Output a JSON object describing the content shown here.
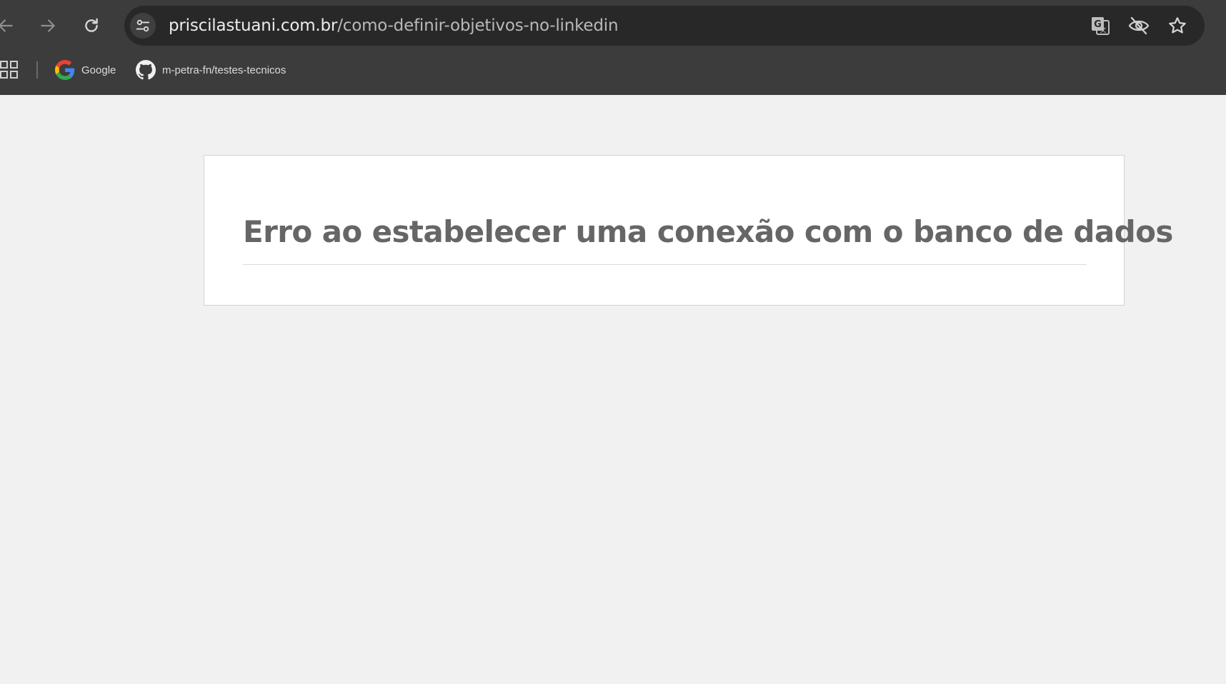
{
  "browser": {
    "url_domain": "priscilastuani.com.br",
    "url_path": "/como-definir-objetivos-no-linkedin",
    "toolbar": {
      "back_icon": "arrow-left-icon",
      "forward_icon": "arrow-right-icon",
      "reload_icon": "reload-icon",
      "site_info_icon": "tune-icon",
      "translate_icon": "translate-icon",
      "tracking_icon": "eye-off-icon",
      "bookmark_icon": "star-icon"
    },
    "bookmarks": [
      {
        "label": "Google",
        "icon": "google-icon"
      },
      {
        "label": "m-petra-fn/testes-tecnicos",
        "icon": "github-icon"
      }
    ],
    "colors": {
      "chrome": "#3c3c3c",
      "omnibox": "#282828",
      "page_bg": "#f1f1f1"
    }
  },
  "page": {
    "error_title": "Erro ao estabelecer uma conexão com o banco de dados"
  }
}
